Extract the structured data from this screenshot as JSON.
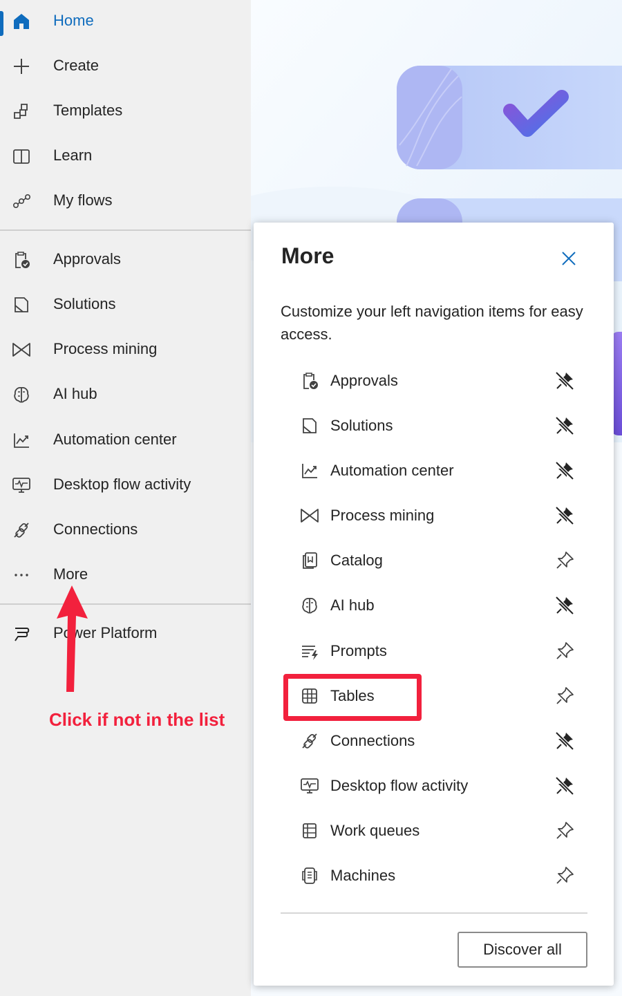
{
  "sidebar": {
    "primary": [
      {
        "label": "Home",
        "icon": "home-icon",
        "active": true
      },
      {
        "label": "Create",
        "icon": "plus-icon"
      },
      {
        "label": "Templates",
        "icon": "templates-icon"
      },
      {
        "label": "Learn",
        "icon": "book-icon"
      },
      {
        "label": "My flows",
        "icon": "flows-icon"
      }
    ],
    "secondary": [
      {
        "label": "Approvals",
        "icon": "approvals-icon"
      },
      {
        "label": "Solutions",
        "icon": "solutions-icon"
      },
      {
        "label": "Process mining",
        "icon": "process-mining-icon"
      },
      {
        "label": "AI hub",
        "icon": "ai-hub-icon"
      },
      {
        "label": "Automation center",
        "icon": "chart-icon"
      },
      {
        "label": "Desktop flow activity",
        "icon": "monitor-pulse-icon"
      },
      {
        "label": "Connections",
        "icon": "plug-icon"
      },
      {
        "label": "More",
        "icon": "ellipsis-icon"
      }
    ],
    "footer": {
      "label": "Power Platform",
      "icon": "power-platform-icon"
    }
  },
  "more_panel": {
    "title": "More",
    "description": "Customize your left navigation items for easy access.",
    "items": [
      {
        "label": "Approvals",
        "icon": "approvals-icon",
        "pinned": true
      },
      {
        "label": "Solutions",
        "icon": "solutions-icon",
        "pinned": true
      },
      {
        "label": "Automation center",
        "icon": "chart-icon",
        "pinned": true
      },
      {
        "label": "Process mining",
        "icon": "process-mining-icon",
        "pinned": true
      },
      {
        "label": "Catalog",
        "icon": "catalog-icon",
        "pinned": false
      },
      {
        "label": "AI hub",
        "icon": "ai-hub-icon",
        "pinned": true
      },
      {
        "label": "Prompts",
        "icon": "prompts-icon",
        "pinned": false
      },
      {
        "label": "Tables",
        "icon": "table-icon",
        "pinned": false
      },
      {
        "label": "Connections",
        "icon": "plug-icon",
        "pinned": true
      },
      {
        "label": "Desktop flow activity",
        "icon": "monitor-pulse-icon",
        "pinned": true
      },
      {
        "label": "Work queues",
        "icon": "work-queues-icon",
        "pinned": false
      },
      {
        "label": "Machines",
        "icon": "machines-icon",
        "pinned": false
      }
    ],
    "discover_label": "Discover all"
  },
  "annotation": {
    "callout": "Click if not in the list",
    "highlighted_item": "Tables"
  },
  "colors": {
    "accent": "#0f6cbd",
    "annotation_red": "#f2213d",
    "sidebar_bg": "#f0f0f0",
    "hero_purple": "#7b6cf0"
  }
}
